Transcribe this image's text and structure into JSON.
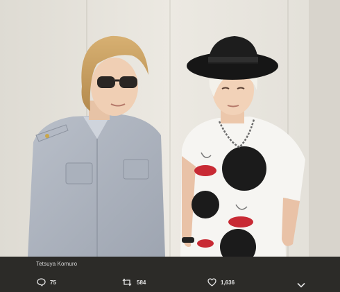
{
  "tweet": {
    "author": "Tetsuya Komuro",
    "photo_alt": "",
    "actions": {
      "reply_count": "75",
      "retweet_count": "584",
      "like_count": "1,636"
    }
  },
  "icons": {
    "reply": "speech-bubble-icon",
    "retweet": "retweet-arrows-icon",
    "like": "heart-icon",
    "more": "chevron-down-icon"
  },
  "colors": {
    "bar_background": "#2c2b28",
    "bar_text": "#e6e6e6"
  }
}
